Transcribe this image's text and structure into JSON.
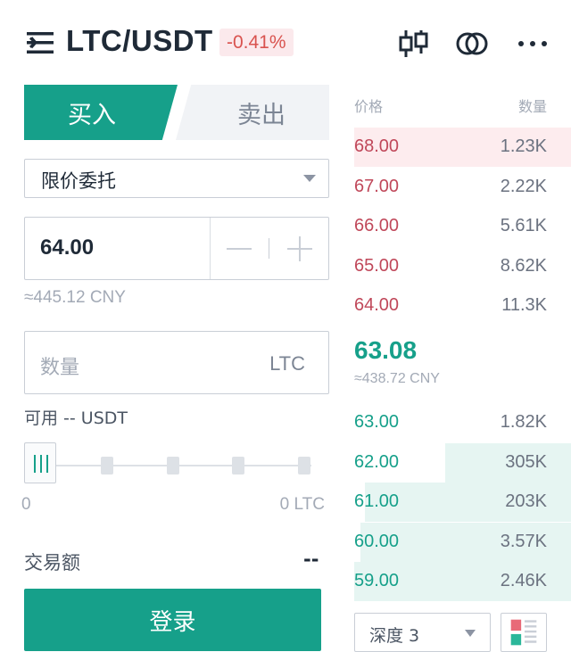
{
  "header": {
    "pair": "LTC/USDT",
    "change": "-0.41%",
    "icons": [
      "menu-icon",
      "candlestick-icon",
      "compare-icon",
      "more-icon"
    ]
  },
  "tabs": {
    "buy": "买入",
    "sell": "卖出",
    "active": "buy"
  },
  "form": {
    "order_type": "限价委托",
    "price": "64.00",
    "cny_estimate": "≈445.12 CNY",
    "quantity_placeholder": "数量",
    "quantity_unit": "LTC",
    "available": "可用 -- USDT",
    "slider_min": "0",
    "slider_max": "0 LTC",
    "slider_value": 0,
    "amount_label": "交易额",
    "amount_value": "--",
    "submit": "登录"
  },
  "orderbook": {
    "price_header": "价格",
    "qty_header": "数量",
    "asks": [
      {
        "price": "68.00",
        "qty": "1.23K",
        "depth": 1.0
      },
      {
        "price": "67.00",
        "qty": "2.22K",
        "depth": 0.0
      },
      {
        "price": "66.00",
        "qty": "5.61K",
        "depth": 0.0
      },
      {
        "price": "65.00",
        "qty": "8.62K",
        "depth": 0.0
      },
      {
        "price": "64.00",
        "qty": "11.3K",
        "depth": 0.0
      }
    ],
    "last_price": "63.08",
    "last_cny": "≈438.72 CNY",
    "bids": [
      {
        "price": "63.00",
        "qty": "1.82K",
        "depth": 0.0
      },
      {
        "price": "62.00",
        "qty": "305K",
        "depth": 0.58
      },
      {
        "price": "61.00",
        "qty": "203K",
        "depth": 0.95
      },
      {
        "price": "60.00",
        "qty": "3.57K",
        "depth": 0.97
      },
      {
        "price": "59.00",
        "qty": "2.46K",
        "depth": 1.0
      }
    ],
    "depth_select": "深度 3"
  },
  "colors": {
    "accent": "#16a08a",
    "ask": "#c0485a",
    "badge_bg": "#fbe9ec"
  }
}
